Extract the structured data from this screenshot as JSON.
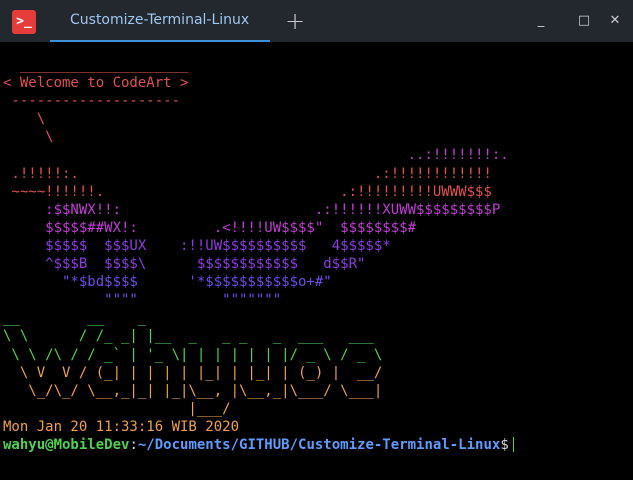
{
  "titlebar": {
    "app_icon": "terminal-icon",
    "tab_title": "Customize-Terminal-Linux",
    "new_tab": "+",
    "minimize": "_",
    "maximize": "□",
    "close": "✕"
  },
  "terminal": {
    "cowsay": [
      "  ____________________",
      "< Welcome to CodeArt >",
      " --------------------",
      "    \\",
      "     \\"
    ],
    "ascii_art": [
      "                                                ..:!!!!!!!:.",
      " .!!!!!:.                                   .:!!!!!!!!!!!!",
      " ~~~~!!!!!!.                            .:!!!!!!!!!UWWW$$$",
      "     :$$NWX!!:                       .:!!!!!!XUWW$$$$$$$$$P",
      "     $$$$$##WX!:         .<!!!!UW$$$$\"  $$$$$$$$#",
      "     $$$$$  $$$UX    :!!UW$$$$$$$$$$   4$$$$$*",
      "     ^$$$B  $$$$\\      $$$$$$$$$$$$   d$$R\"",
      "       \"*$bd$$$$      '*$$$$$$$$$$$o+#\"",
      "            \"\"\"\"          \"\"\"\"\"\"\""
    ],
    "figlet": [
      "__        __    _                        ",
      "\\ \\      / /_ _| |__  _   _ _   _  ___   ___  ",
      " \\ \\ /\\ / / _` | '_ \\| | | | | | |/ _ \\ / _ \\ ",
      "  \\ V  V / (_| | | | | |_| | |_| | (_) |  __/ ",
      "   \\_/\\_/ \\__,_|_| |_|\\__, |\\__,_|\\___/ \\___| ",
      "                      |___/                     "
    ],
    "date_line": "Mon Jan 20 11:33:16 WIB 2020",
    "prompt_user": "wahyu@MobileDev",
    "prompt_sep": ":",
    "prompt_path": "~/Documents/GITHUB/Customize-Terminal-Linux",
    "prompt_symbol": "$"
  }
}
